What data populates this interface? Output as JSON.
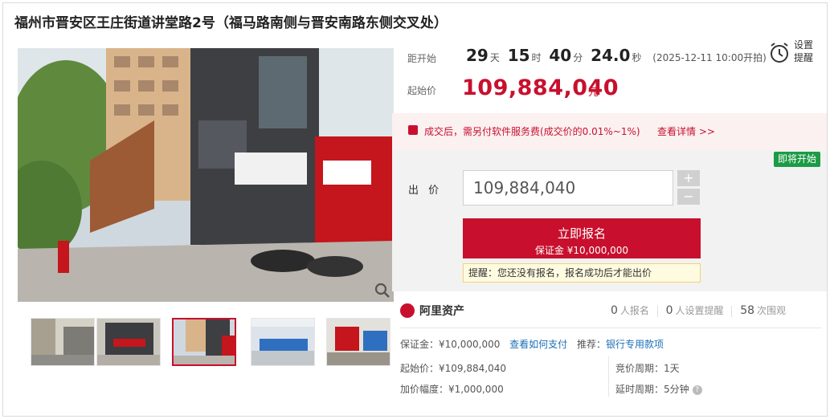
{
  "title": "福州市晋安区王庄街道讲堂路2号（福马路南侧与晋安南路东侧交叉处）",
  "countdown": {
    "label": "距开始",
    "days": "29",
    "days_unit": "天",
    "hours": "15",
    "hours_unit": "时",
    "minutes": "40",
    "minutes_unit": "分",
    "seconds": "24.0",
    "seconds_unit": "秒",
    "start_time": "(2025-12-11 10:00开拍)"
  },
  "reminder": {
    "label": "设置提醒",
    "icon": "alarm-clock-icon"
  },
  "start_price": {
    "label": "起始价",
    "value": "109,884,040",
    "unit": "元"
  },
  "fee_notice": {
    "text": "成交后，需另付软件服务费(成交价的0.01%~1%)",
    "link": "查看详情 >>"
  },
  "status_tag": "即将开始",
  "bid": {
    "label": "出 价",
    "input_value": "109,884,040",
    "plus": "+",
    "minus": "−"
  },
  "signup_button": {
    "title": "立即报名",
    "subtitle": "保证金 ¥10,000,000"
  },
  "warning": "提醒：您还没有报名，报名成功后才能出价",
  "platform": {
    "name": "阿里资产"
  },
  "stats": {
    "signups": "0",
    "signups_label": "人报名",
    "reminders": "0",
    "reminders_label": "人设置提醒",
    "views": "58",
    "views_label": "次围观"
  },
  "details": {
    "deposit": "保证金：¥10,000,000",
    "how_to_pay": "查看如何支付",
    "recommend_label": "推荐：",
    "recommend_link": "银行专用款项",
    "start_price": "起始价：¥109,884,040",
    "increment": "加价幅度：¥1,000,000",
    "auction_cycle": "竞价周期：1天",
    "delay_cycle": "延时周期：5分钟"
  },
  "colors": {
    "accent": "#c8102e",
    "tag_green": "#1c9b45",
    "link_blue": "#1a6fb5"
  }
}
